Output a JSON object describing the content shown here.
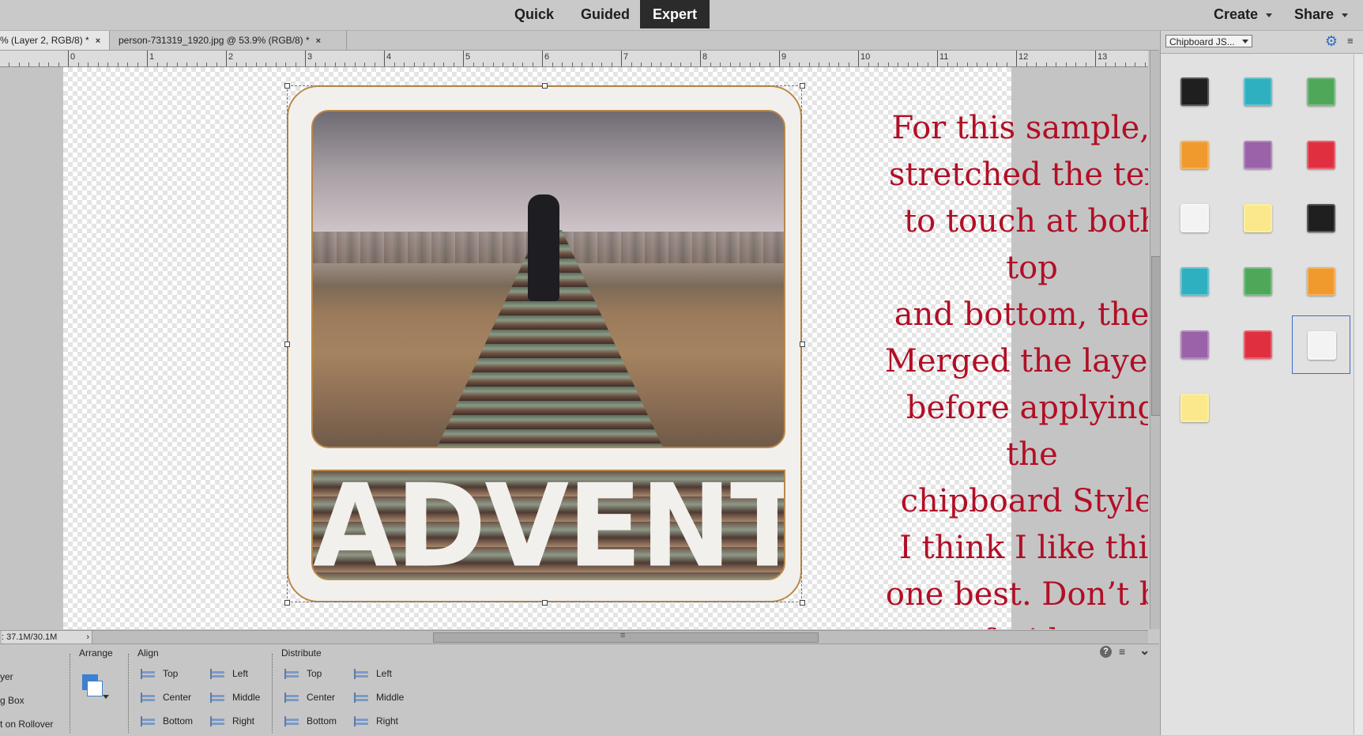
{
  "modes": {
    "quick": "Quick",
    "guided": "Guided",
    "expert": "Expert"
  },
  "top_right": {
    "create": "Create",
    "share": "Share"
  },
  "tabs": [
    {
      "label": "% (Layer 2, RGB/8) *",
      "close": "×"
    },
    {
      "label": "person-731319_1920.jpg @ 53.9% (RGB/8) *",
      "close": "×"
    }
  ],
  "ruler": {
    "labels": [
      "0",
      "1",
      "2",
      "3",
      "4",
      "5",
      "6",
      "7",
      "8",
      "9",
      "10",
      "11",
      "12",
      "13"
    ]
  },
  "canvas": {
    "word": "ADVENTURE",
    "note": "For this sample, I\nstretched the text\nto touch at both top\nand bottom, then\nMerged the layers\nbefore applying the\nchipboard Style.\nI think I like this\none best. Don’t be\nafraid to experiment!"
  },
  "status": {
    "text": ": 37.1M/30.1M",
    "arrow": "›",
    "grip": "≡"
  },
  "options": {
    "left_items": [
      "yer",
      "g Box",
      "t on Rollover"
    ],
    "arrange": "Arrange",
    "align": {
      "heading": "Align",
      "col1": [
        "Top",
        "Center",
        "Bottom"
      ],
      "col2": [
        "Left",
        "Middle",
        "Right"
      ]
    },
    "distribute": {
      "heading": "Distribute",
      "col1": [
        "Top",
        "Center",
        "Bottom"
      ],
      "col2": [
        "Left",
        "Middle",
        "Right"
      ]
    },
    "help": "?",
    "menu": "≡",
    "collapse": "⌄"
  },
  "panel": {
    "dropdown": "Chipboard JS...",
    "gear": "⚙",
    "menu": "≡",
    "swatches": [
      "#1f1f1f",
      "#2fb0c0",
      "#4fa85a",
      "#f09a2e",
      "#9a62a8",
      "#e03040",
      "#f3f3f3",
      "#fbe88a",
      "#1f1f1f",
      "#2fb0c0",
      "#4fa85a",
      "#f09a2e",
      "#9a62a8",
      "#e03040",
      "#f3f3f3",
      "#fbe88a"
    ],
    "selected_index": 14
  },
  "colors": {
    "note_red": "#b10f26",
    "accent_blue": "#3d6fcc",
    "expert_bg": "#2b2b2b"
  }
}
